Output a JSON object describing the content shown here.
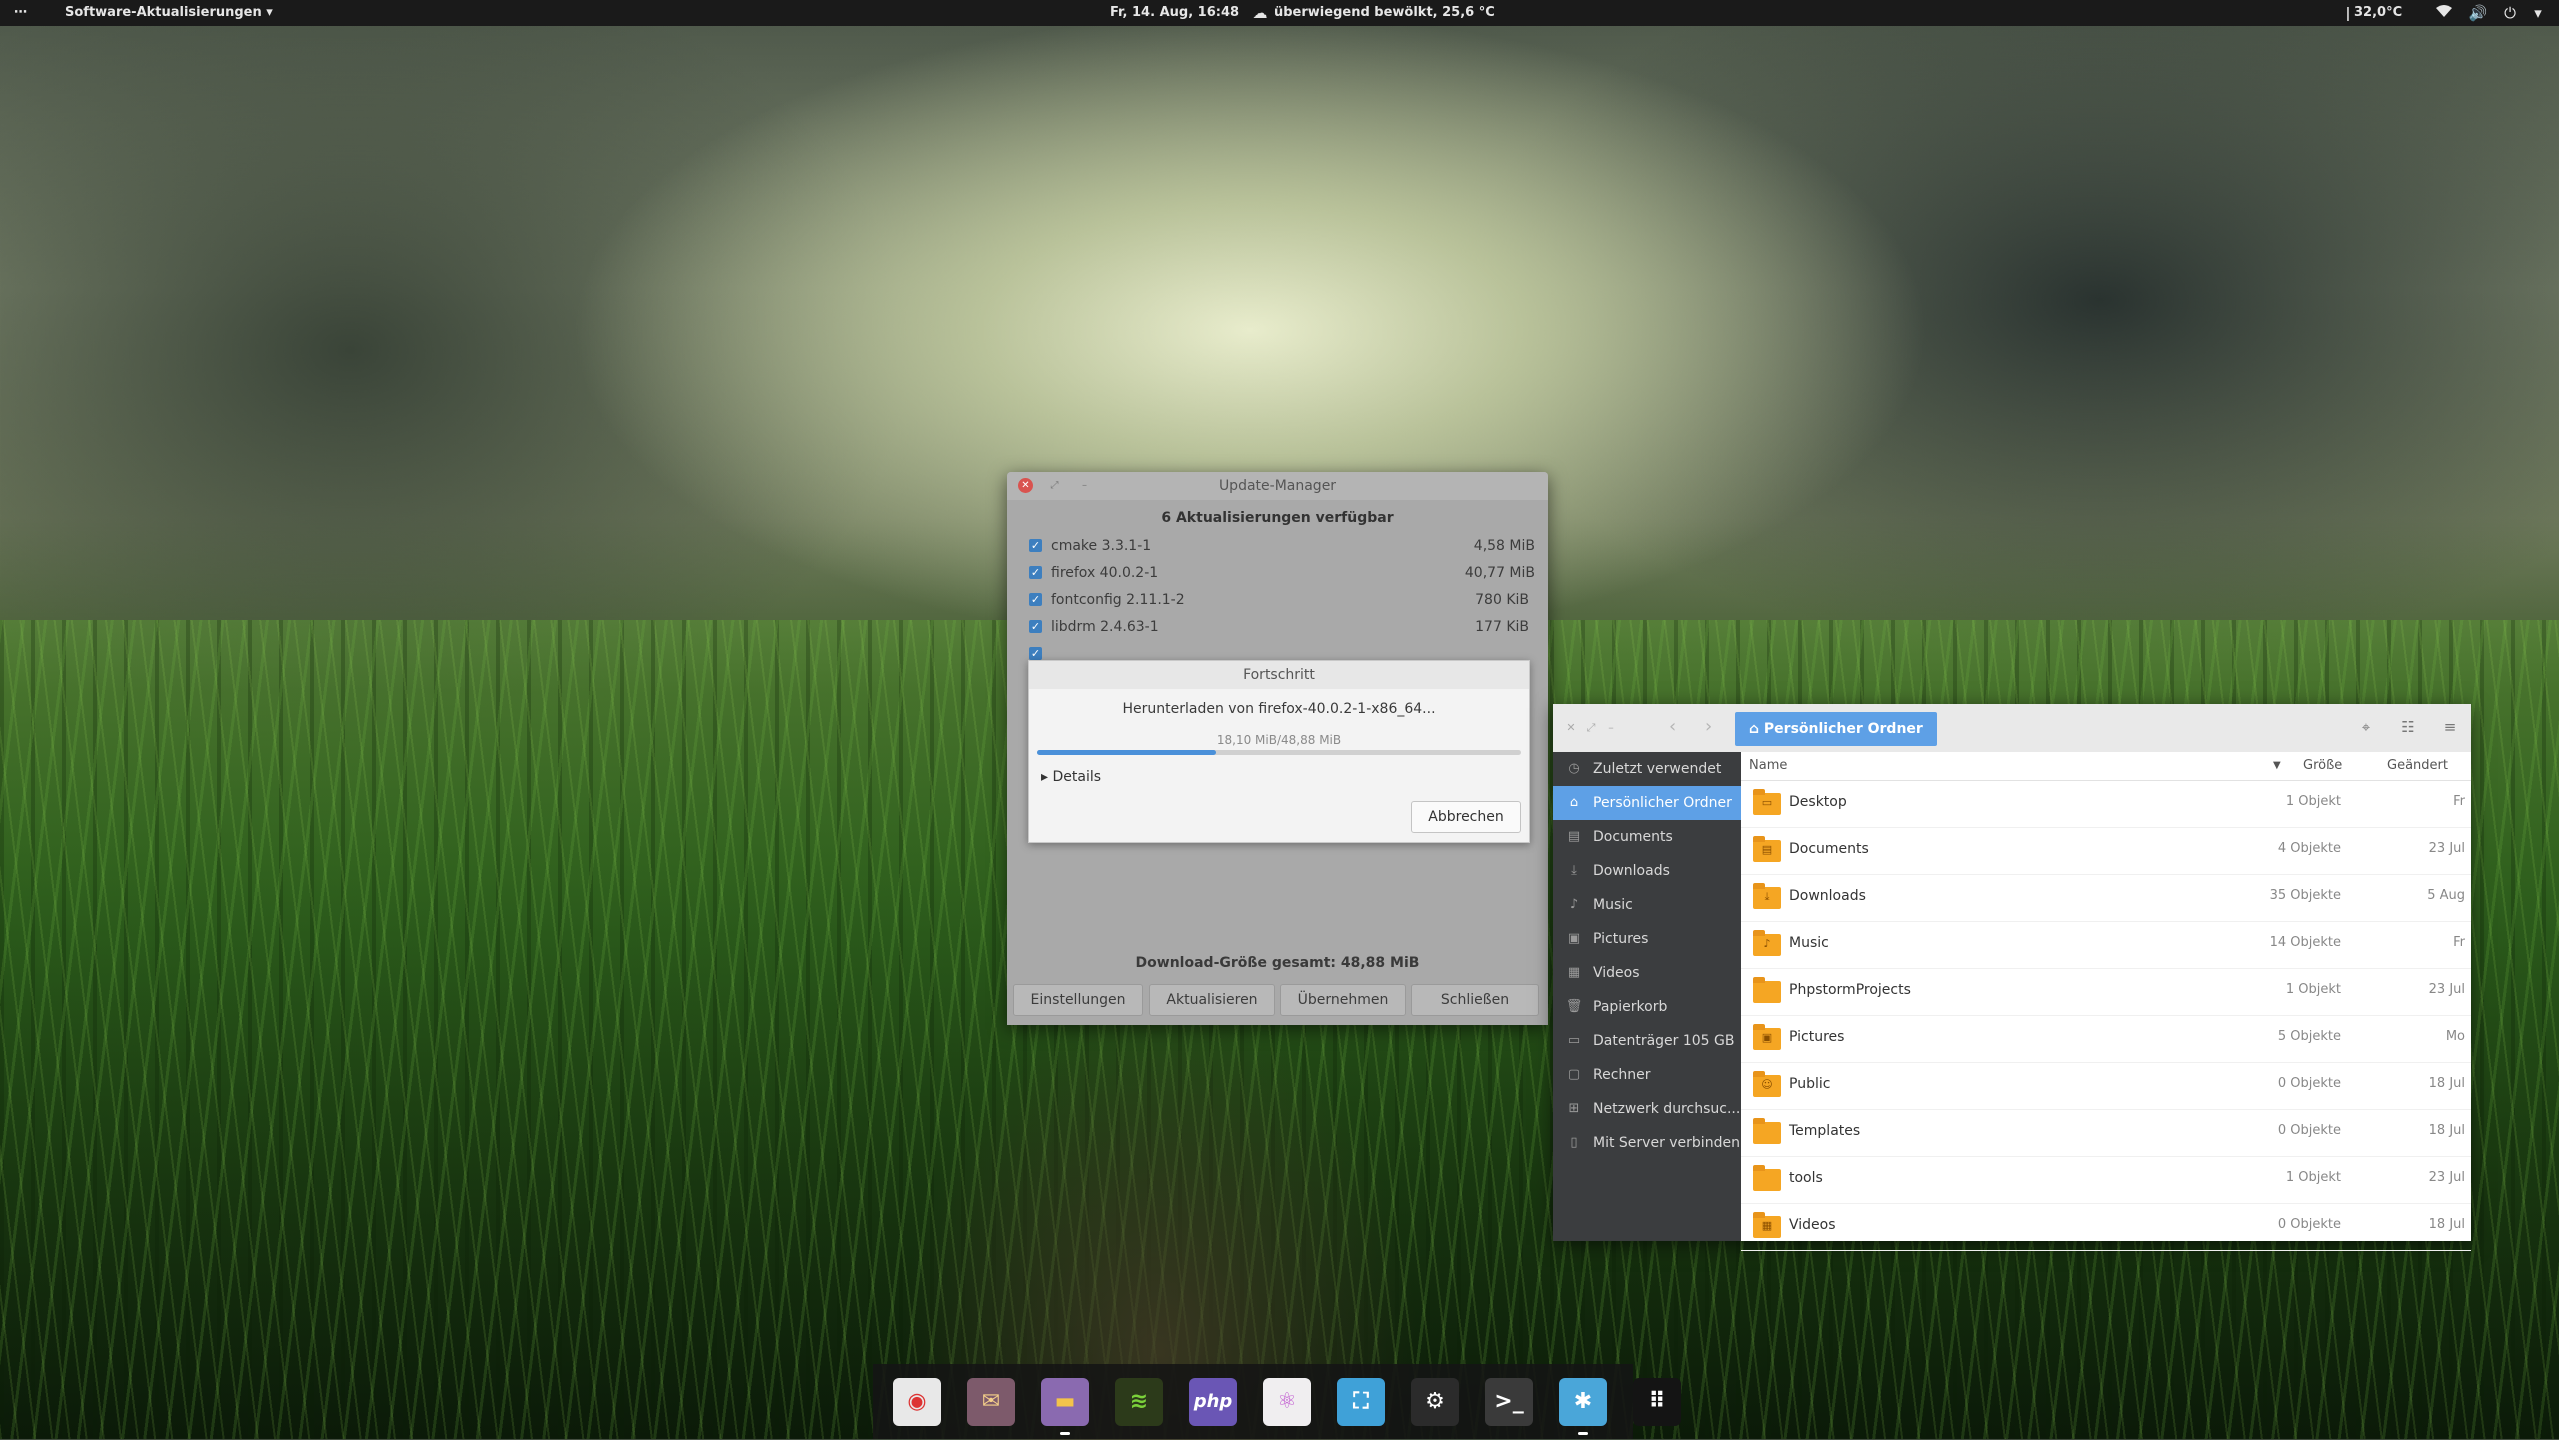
{
  "topbar": {
    "dots": "⋯",
    "app_menu": "Software-Aktualisierungen ▾",
    "clock": "Fr, 14. Aug, 16:48",
    "weather": "überwiegend bewölkt, 25,6 °C",
    "temperature": "32,0°C",
    "icons": [
      "weather-cloud-icon",
      "thermometer-icon",
      "wifi-icon",
      "volume-icon",
      "power-icon",
      "chevron-down-icon"
    ]
  },
  "update_manager": {
    "title": "Update-Manager",
    "heading": "6 Aktualisierungen verfügbar",
    "packages": [
      {
        "name": "cmake 3.3.1-1",
        "size": "4,58 MiB"
      },
      {
        "name": "firefox 40.0.2-1",
        "size": "40,77 MiB"
      },
      {
        "name": "fontconfig 2.11.1-2",
        "size": "780 KiB"
      },
      {
        "name": "libdrm 2.4.63-1",
        "size": "177 KiB"
      }
    ],
    "total": "Download-Größe gesamt: 48,88 MiB",
    "buttons": {
      "settings": "Einstellungen",
      "refresh": "Aktualisieren",
      "apply": "Übernehmen",
      "close": "Schließen"
    }
  },
  "progress": {
    "title": "Fortschritt",
    "message": "Herunterladen von firefox-40.0.2-1-x86_64...",
    "amount": "18,10 MiB/48,88 MiB",
    "fraction": 0.37,
    "details": "Details",
    "cancel": "Abbrechen"
  },
  "files": {
    "path": "Persönlicher Ordner",
    "sidebar": [
      {
        "label": "Zuletzt verwendet",
        "icon": "clock-icon"
      },
      {
        "label": "Persönlicher Ordner",
        "icon": "home-icon",
        "active": true
      },
      {
        "label": "Documents",
        "icon": "document-icon"
      },
      {
        "label": "Downloads",
        "icon": "download-icon"
      },
      {
        "label": "Music",
        "icon": "music-icon"
      },
      {
        "label": "Pictures",
        "icon": "picture-icon"
      },
      {
        "label": "Videos",
        "icon": "video-icon"
      },
      {
        "label": "Papierkorb",
        "icon": "trash-icon"
      },
      {
        "label": "Datenträger 105 GB",
        "icon": "drive-icon"
      },
      {
        "label": "Rechner",
        "icon": "computer-icon"
      },
      {
        "label": "Netzwerk durchsuc...",
        "icon": "network-icon"
      },
      {
        "label": "Mit Server verbinden",
        "icon": "server-icon"
      }
    ],
    "columns": {
      "name": "Name",
      "size": "Größe",
      "modified": "Geändert"
    },
    "rows": [
      {
        "name": "Desktop",
        "size": "1 Objekt",
        "modified": "Fr",
        "icon": "desktop-folder-icon"
      },
      {
        "name": "Documents",
        "size": "4 Objekte",
        "modified": "23 Jul",
        "icon": "documents-folder-icon"
      },
      {
        "name": "Downloads",
        "size": "35 Objekte",
        "modified": "5 Aug",
        "icon": "downloads-folder-icon"
      },
      {
        "name": "Music",
        "size": "14 Objekte",
        "modified": "Fr",
        "icon": "music-folder-icon"
      },
      {
        "name": "PhpstormProjects",
        "size": "1 Objekt",
        "modified": "23 Jul",
        "icon": "folder-icon"
      },
      {
        "name": "Pictures",
        "size": "5 Objekte",
        "modified": "Mo",
        "icon": "pictures-folder-icon"
      },
      {
        "name": "Public",
        "size": "0 Objekte",
        "modified": "18 Jul",
        "icon": "public-folder-icon"
      },
      {
        "name": "Templates",
        "size": "0 Objekte",
        "modified": "18 Jul",
        "icon": "templates-folder-icon"
      },
      {
        "name": "tools",
        "size": "1 Objekt",
        "modified": "23 Jul",
        "icon": "folder-icon"
      },
      {
        "name": "Videos",
        "size": "0 Objekte",
        "modified": "18 Jul",
        "icon": "videos-folder-icon"
      }
    ]
  },
  "dock": [
    {
      "name": "chrome-icon",
      "color": "#e8e8e8"
    },
    {
      "name": "mail-icon",
      "color": "#7d5a6b"
    },
    {
      "name": "files-icon",
      "color": "#8a6ab0"
    },
    {
      "name": "spotify-icon",
      "color": "#2c3a1a"
    },
    {
      "name": "phpstorm-icon",
      "color": "#6a56b5",
      "text": "php"
    },
    {
      "name": "atom-icon",
      "color": "#f0eef0"
    },
    {
      "name": "screenshot-icon",
      "color": "#3fa1d8"
    },
    {
      "name": "steam-icon",
      "color": "#2b2b2b"
    },
    {
      "name": "terminal-icon",
      "color": "#3a3a3a"
    },
    {
      "name": "settings-icon",
      "color": "#4aa6d9"
    },
    {
      "name": "app-grid-icon",
      "color": "#141414"
    }
  ]
}
